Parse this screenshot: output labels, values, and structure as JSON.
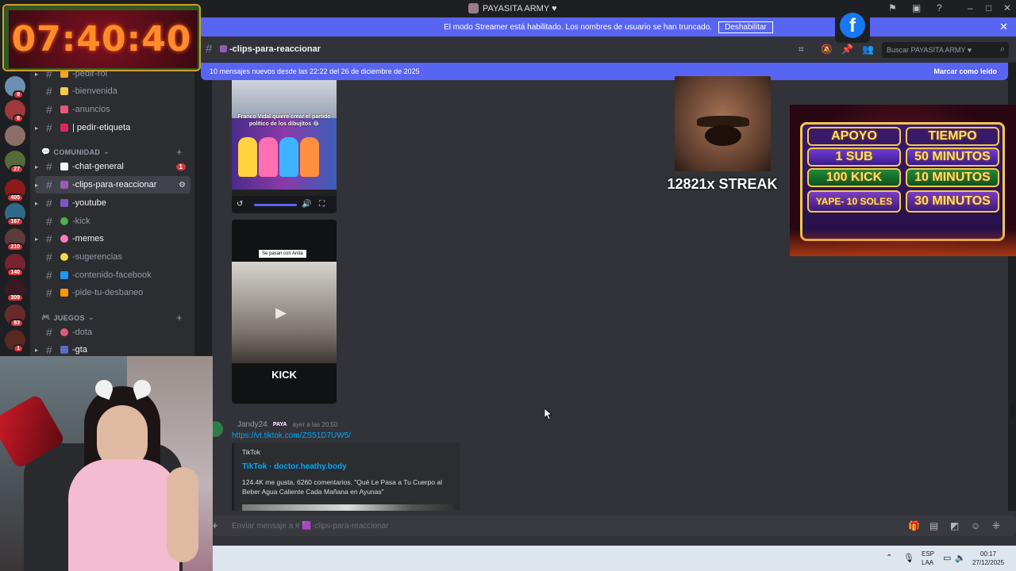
{
  "window": {
    "title": "PAYASITA ARMY ♥"
  },
  "streamer_banner": {
    "text": "El modo Streamer está habilitado. Los nombres de usuario se han truncado.",
    "button": "Deshabilitar",
    "close": "✕"
  },
  "header": {
    "channel": "-clips-para-reaccionar",
    "search_placeholder": "Buscar PAYASITA ARMY ♥"
  },
  "new_messages": {
    "text": "10 mensajes nuevos desde las 22:22 del 26 de diciembre de 2025",
    "action": "Marcar como leído"
  },
  "guild_badges": [
    "9",
    "6",
    "27",
    "405",
    "167",
    "210",
    "140",
    "309",
    "83",
    "1"
  ],
  "sidebar": {
    "channels_top": [
      {
        "label": "-pedir-rol"
      },
      {
        "label": "-bienvenida"
      },
      {
        "label": "-anuncios"
      },
      {
        "label": "| pedir-etiqueta"
      }
    ],
    "category_comunidad": "COMUNIDAD",
    "channels_comunidad": [
      {
        "label": "-chat-general",
        "badge": "1"
      },
      {
        "label": "-clips-para-reaccionar"
      },
      {
        "label": "-youtube"
      },
      {
        "label": "-kick"
      },
      {
        "label": "-memes"
      },
      {
        "label": "-sugerencias"
      },
      {
        "label": "-contenido-facebook"
      },
      {
        "label": "-pide-tu-desbaneo"
      }
    ],
    "category_juegos": "JUEGOS",
    "channels_juegos": [
      {
        "label": "-dota"
      },
      {
        "label": "-gta"
      }
    ]
  },
  "video1": {
    "caption": "Franco Vidal quiere crear el partido político de los dibujitos 😂"
  },
  "video2": {
    "label": "Se pasan con Anita",
    "overlay": "KICK"
  },
  "message": {
    "username": "Jandy24",
    "tag": "PAYA",
    "time": "ayer a las 20:50",
    "link": "https://vt.tiktok.com/ZS51D7UW5/",
    "embed": {
      "provider": "TikTok",
      "title": "TikTok · doctor.heathy.body",
      "description": "124.4K me gusta, 6260 comentarios. \"Qué Le Pasa a Tu Cuerpo al Beber Agua Caliente Cada Mañana en Ayunas\""
    }
  },
  "composer": {
    "placeholder": "Enviar mensaje a # 🟪-clips-para-reaccionar"
  },
  "overlay_clock": {
    "time": "07:40:40"
  },
  "overlay_streak": {
    "text": "12821x STREAK"
  },
  "overlay_promo": {
    "headers": [
      "APOYO",
      "TIEMPO"
    ],
    "rows": [
      {
        "left": "1 SUB",
        "right": "50 MINUTOS"
      },
      {
        "left": "100 KICK",
        "right": "10 MINUTOS"
      },
      {
        "left": "YAPE- 10 SOLES",
        "right": "30 MINUTOS"
      }
    ]
  },
  "taskbar": {
    "lang": "ESP",
    "lang2": "LAA",
    "time": "00:17",
    "date": "27/12/2025"
  },
  "colors": {
    "accent": "#5865f2",
    "link": "#00a8fc",
    "badge": "#da373c"
  }
}
